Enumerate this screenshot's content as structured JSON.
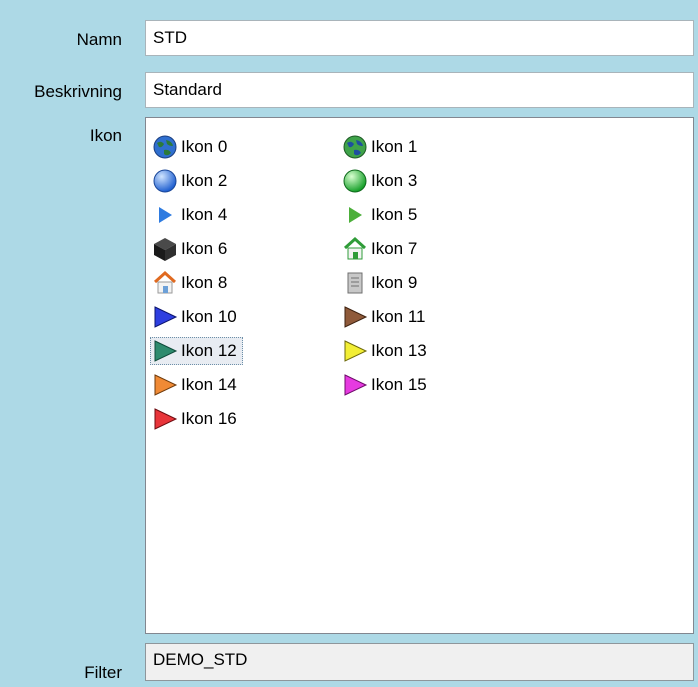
{
  "labels": {
    "name": "Namn",
    "description": "Beskrivning",
    "icon": "Ikon",
    "filter": "Filter"
  },
  "fields": {
    "name": "STD",
    "description": "Standard",
    "filter": "DEMO_STD"
  },
  "icon_list": {
    "selected_index": 12,
    "items": [
      {
        "label": "Ikon 0",
        "icon": "globe-blue-icon"
      },
      {
        "label": "Ikon 1",
        "icon": "globe-green-icon"
      },
      {
        "label": "Ikon 2",
        "icon": "sphere-blue-icon"
      },
      {
        "label": "Ikon 3",
        "icon": "sphere-green-icon"
      },
      {
        "label": "Ikon 4",
        "icon": "arrow-blue-icon"
      },
      {
        "label": "Ikon 5",
        "icon": "arrow-green-icon"
      },
      {
        "label": "Ikon 6",
        "icon": "cube-black-icon"
      },
      {
        "label": "Ikon 7",
        "icon": "house-green-icon"
      },
      {
        "label": "Ikon 8",
        "icon": "house-orange-icon"
      },
      {
        "label": "Ikon 9",
        "icon": "server-gray-icon"
      },
      {
        "label": "Ikon 10",
        "icon": "triangle-blue-icon"
      },
      {
        "label": "Ikon 11",
        "icon": "triangle-brown-icon"
      },
      {
        "label": "Ikon 12",
        "icon": "triangle-teal-icon"
      },
      {
        "label": "Ikon 13",
        "icon": "triangle-yellow-icon"
      },
      {
        "label": "Ikon 14",
        "icon": "triangle-orange-icon"
      },
      {
        "label": "Ikon 15",
        "icon": "triangle-magenta-icon"
      },
      {
        "label": "Ikon 16",
        "icon": "triangle-red-icon"
      }
    ]
  }
}
